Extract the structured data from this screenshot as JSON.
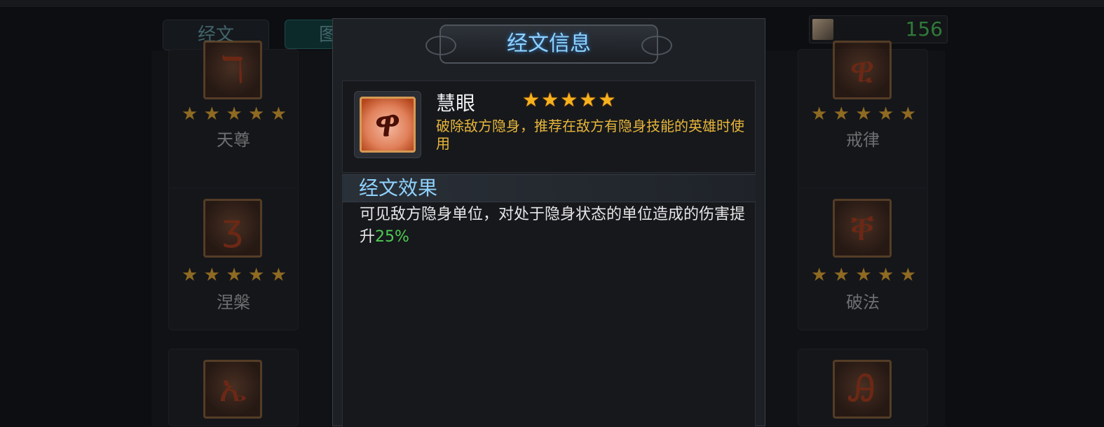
{
  "tabs": [
    {
      "label": "经文"
    },
    {
      "label": "图"
    }
  ],
  "currency": {
    "value": "156",
    "icon": "scroll-icon"
  },
  "cards": [
    {
      "name": "天尊",
      "stars": 5
    },
    {
      "name": "戒律",
      "stars": 5
    },
    {
      "name": "涅槃",
      "stars": 5
    },
    {
      "name": "破法",
      "stars": 5
    },
    {
      "name": "",
      "stars": 0
    },
    {
      "name": "",
      "stars": 0
    }
  ],
  "dialog": {
    "title": "经文信息",
    "item": {
      "name": "慧眼",
      "stars": 5,
      "description": "破除敌方隐身，推荐在敌方有隐身技能的英雄时使用"
    },
    "section_title": "经文效果",
    "effect": {
      "text": "可见敌方隐身单位，对处于隐身状态的单位造成的伤害提升",
      "highlight": "25%",
      "highlight_color": "#4ecb52"
    }
  },
  "colors": {
    "title_blue": "#8fd2ff",
    "desc_yellow": "#e8b63a",
    "star_gold": "#f6b21e"
  }
}
